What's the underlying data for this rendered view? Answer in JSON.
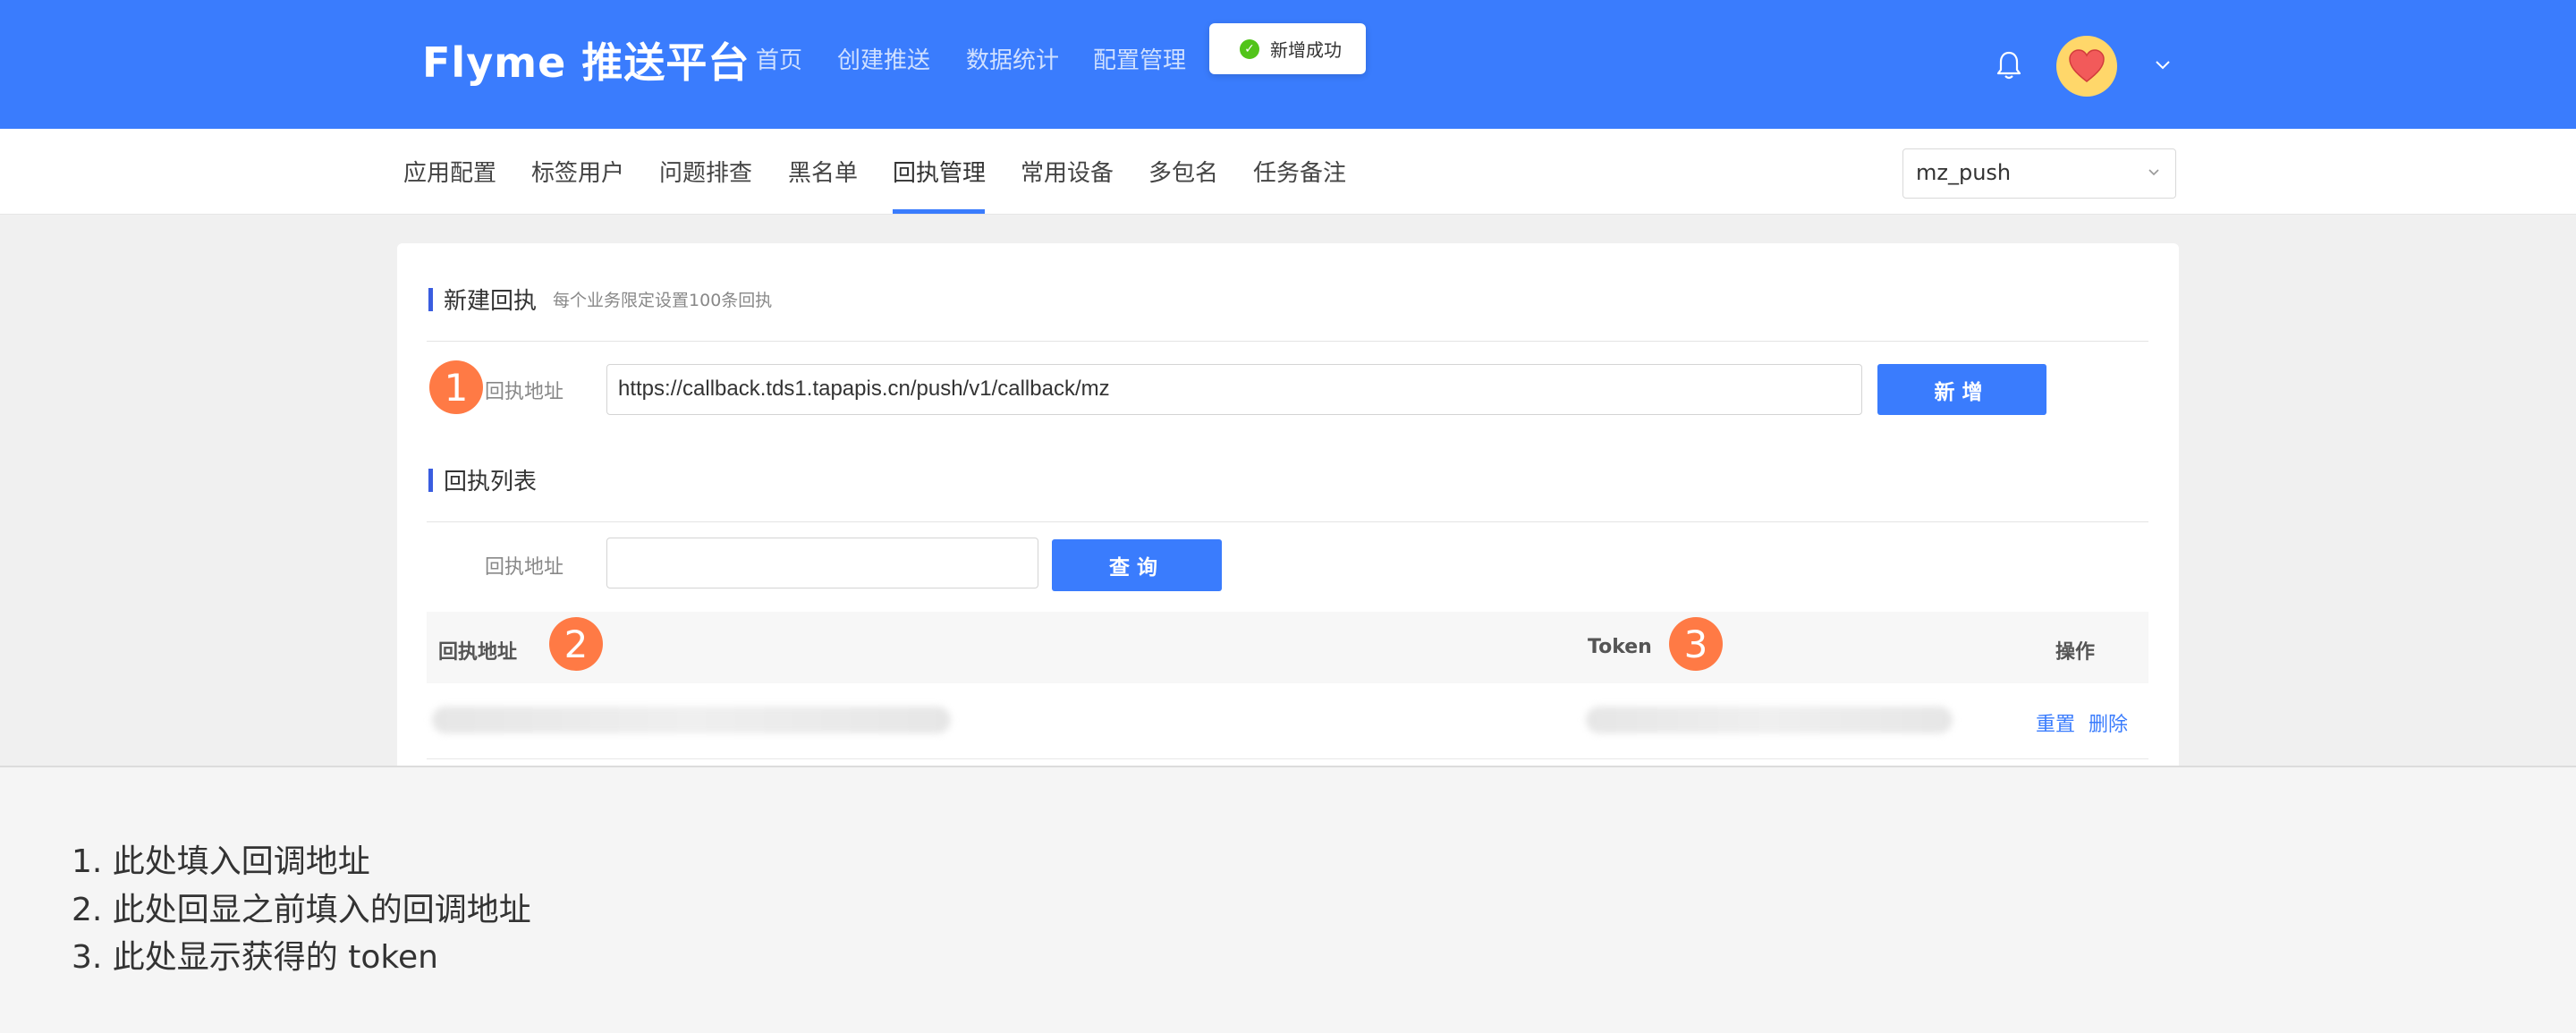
{
  "header": {
    "logo": "Flyme 推送平台",
    "nav": [
      "首页",
      "创建推送",
      "数据统计",
      "配置管理"
    ],
    "toast": "新增成功"
  },
  "subnav": {
    "items": [
      "应用配置",
      "标签用户",
      "问题排查",
      "黑名单",
      "回执管理",
      "常用设备",
      "多包名",
      "任务备注"
    ],
    "active": "回执管理",
    "app_select": "mz_push"
  },
  "new_receipt": {
    "title": "新建回执",
    "hint": "每个业务限定设置100条回执",
    "field_label": "回执地址",
    "url_value": "https://callback.tds1.tapapis.cn/push/v1/callback/mz",
    "add_button": "新增"
  },
  "receipt_list": {
    "title": "回执列表",
    "field_label": "回执地址",
    "search_value": "",
    "query_button": "查询",
    "columns": [
      "回执地址",
      "Token",
      "操作"
    ],
    "row_actions": [
      "重置",
      "删除"
    ]
  },
  "markers": [
    "1",
    "2",
    "3"
  ],
  "notes": [
    "1. 此处填入回调地址",
    "2. 此处回显之前填入的回调地址",
    "3. 此处显示获得的 token"
  ],
  "colors": {
    "primary": "#3a7cfd",
    "marker": "#ff7a45",
    "success": "#52c41a"
  }
}
